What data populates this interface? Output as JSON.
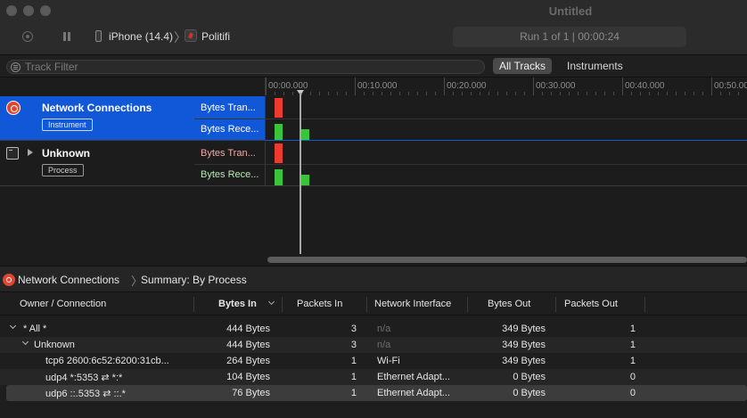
{
  "window": {
    "title": "Untitled"
  },
  "toolbar": {
    "device_label": "iPhone (14.4)",
    "app_label": "Politifi",
    "run_status": "Run 1 of 1  |  00:00:24"
  },
  "filter_bar": {
    "placeholder": "Track Filter",
    "tabs": [
      {
        "label": "All Tracks",
        "selected": true
      },
      {
        "label": "Instruments",
        "selected": false
      }
    ]
  },
  "timeline": {
    "ticks": [
      "00:00.000",
      "00:10.000",
      "00:20.000",
      "00:30.000",
      "00:40.000",
      "00:50.00"
    ]
  },
  "tracks": [
    {
      "title": "Network Connections",
      "badge": "Instrument",
      "icon": "network-connections-icon",
      "selected": true,
      "subtracks": [
        "Bytes Tran...",
        "Bytes Rece..."
      ]
    },
    {
      "title": "Unknown",
      "badge": "Process",
      "icon": "process-icon",
      "selected": false,
      "subtracks": [
        "Bytes Tran...",
        "Bytes Rece..."
      ]
    }
  ],
  "detail": {
    "breadcrumb": [
      "Network Connections",
      "Summary: By Process"
    ]
  },
  "table": {
    "columns": [
      "Owner / Connection",
      "Bytes In",
      "Packets In",
      "Network Interface",
      "Bytes Out",
      "Packets Out"
    ],
    "rows": [
      {
        "owner": "* All *",
        "bytes_in": "444 Bytes",
        "packets_in": "3",
        "interface": "n/a",
        "bytes_out": "349 Bytes",
        "packets_out": "1"
      },
      {
        "owner": "Unknown",
        "bytes_in": "444 Bytes",
        "packets_in": "3",
        "interface": "n/a",
        "bytes_out": "349 Bytes",
        "packets_out": "1"
      },
      {
        "owner": "tcp6 2600:6c52:6200:31cb...",
        "bytes_in": "264 Bytes",
        "packets_in": "1",
        "interface": "Wi-Fi",
        "bytes_out": "349 Bytes",
        "packets_out": "1"
      },
      {
        "owner": "udp4 *:5353 ⇄ *:*",
        "bytes_in": "104 Bytes",
        "packets_in": "1",
        "interface": "Ethernet Adapt...",
        "bytes_out": "0 Bytes",
        "packets_out": "0"
      },
      {
        "owner": "udp6 ::.5353 ⇄ ::.*",
        "bytes_in": "76 Bytes",
        "packets_in": "1",
        "interface": "Ethernet Adapt...",
        "bytes_out": "0 Bytes",
        "packets_out": "0"
      }
    ]
  },
  "colors": {
    "selection_blue": "#1158d9",
    "bytes_transmitted": "#ee3b30",
    "bytes_received": "#3ac43a"
  }
}
